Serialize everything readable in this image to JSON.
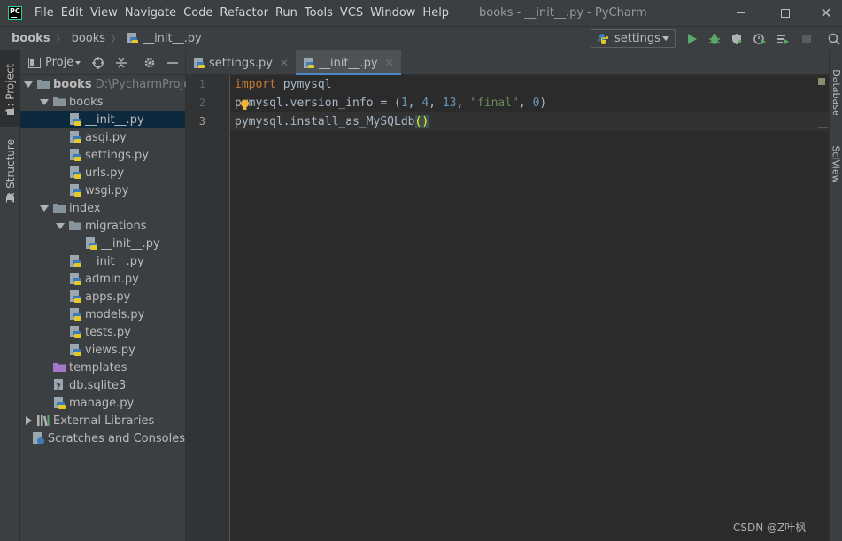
{
  "app": {
    "logo": "PC",
    "window_title": "books - __init__.py - PyCharm"
  },
  "menu": [
    "File",
    "Edit",
    "View",
    "Navigate",
    "Code",
    "Refactor",
    "Run",
    "Tools",
    "VCS",
    "Window",
    "Help"
  ],
  "breadcrumb": {
    "root": "books",
    "folder": "books",
    "file": "__init__.py"
  },
  "run_config": {
    "label": "settings",
    "icon": "python-icon"
  },
  "toolbar_icons": [
    "run-icon",
    "debug-icon",
    "coverage-icon",
    "profile-icon",
    "run-tasks-icon",
    "stop-icon",
    "search-icon"
  ],
  "left_tool_tabs": {
    "project": "1: Project",
    "structure": "Z: Structure"
  },
  "right_tool_tabs": {
    "database": "Database",
    "sciview": "SciView"
  },
  "project_panel": {
    "title": "Proje",
    "tree": [
      {
        "label": "books",
        "path": "D:\\PycharmProject",
        "depth": 0,
        "type": "folder",
        "expanded": true
      },
      {
        "label": "books",
        "depth": 1,
        "type": "folder",
        "expanded": true
      },
      {
        "label": "__init__.py",
        "depth": 2,
        "type": "python",
        "selected": true
      },
      {
        "label": "asgi.py",
        "depth": 2,
        "type": "python"
      },
      {
        "label": "settings.py",
        "depth": 2,
        "type": "python"
      },
      {
        "label": "urls.py",
        "depth": 2,
        "type": "python"
      },
      {
        "label": "wsgi.py",
        "depth": 2,
        "type": "python"
      },
      {
        "label": "index",
        "depth": 1,
        "type": "folder",
        "expanded": true
      },
      {
        "label": "migrations",
        "depth": 2,
        "type": "folder",
        "expanded": true
      },
      {
        "label": "__init__.py",
        "depth": 3,
        "type": "python"
      },
      {
        "label": "__init__.py",
        "depth": 2,
        "type": "python"
      },
      {
        "label": "admin.py",
        "depth": 2,
        "type": "python"
      },
      {
        "label": "apps.py",
        "depth": 2,
        "type": "python"
      },
      {
        "label": "models.py",
        "depth": 2,
        "type": "python"
      },
      {
        "label": "tests.py",
        "depth": 2,
        "type": "python"
      },
      {
        "label": "views.py",
        "depth": 2,
        "type": "python"
      },
      {
        "label": "templates",
        "depth": 1,
        "type": "templates-folder"
      },
      {
        "label": "db.sqlite3",
        "depth": 1,
        "type": "db"
      },
      {
        "label": "manage.py",
        "depth": 1,
        "type": "python"
      },
      {
        "label": "External Libraries",
        "depth": 0,
        "type": "libraries",
        "collapsed": true
      },
      {
        "label": "Scratches and Consoles",
        "depth": 0,
        "type": "scratches"
      }
    ]
  },
  "tabs": [
    {
      "label": "settings.py",
      "active": false
    },
    {
      "label": "__init__.py",
      "active": true
    }
  ],
  "editor": {
    "line_numbers": [
      "1",
      "2",
      "3"
    ],
    "current_line": 3
  },
  "watermark": "CSDN @Z叶枫",
  "colors": {
    "background": "#2b2b2b",
    "chrome": "#3c3f41",
    "keyword": "#cc7832",
    "number": "#6897bb",
    "string": "#6a8759",
    "selection": "#0d293e",
    "tab_underline": "#4a88c7"
  }
}
